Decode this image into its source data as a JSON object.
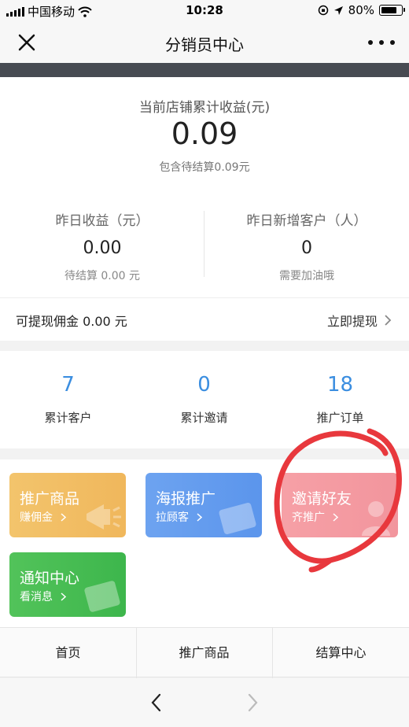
{
  "status_bar": {
    "carrier": "中国移动",
    "time": "10:28",
    "battery": "80%",
    "battery_level": 0.8
  },
  "nav": {
    "title": "分销员中心"
  },
  "earnings": {
    "total_label": "当前店铺累计收益(元)",
    "total_value": "0.09",
    "total_note": "包含待结算0.09元",
    "yesterday_income_label": "昨日收益（元）",
    "yesterday_income_value": "0.00",
    "yesterday_income_note": "待结算 0.00 元",
    "new_customers_label": "昨日新增客户（人）",
    "new_customers_value": "0",
    "new_customers_note": "需要加油哦",
    "withdrawable": "可提现佣金 0.00 元",
    "withdraw_action": "立即提现"
  },
  "counts": [
    {
      "value": "7",
      "label": "累计客户"
    },
    {
      "value": "0",
      "label": "累计邀请"
    },
    {
      "value": "18",
      "label": "推广订单"
    }
  ],
  "tiles": {
    "goods": {
      "title": "推广商品",
      "sub": "赚佣金"
    },
    "poster": {
      "title": "海报推广",
      "sub": "拉顾客"
    },
    "invite": {
      "title": "邀请好友",
      "sub": "齐推广"
    },
    "notice": {
      "title": "通知中心",
      "sub": "看消息"
    }
  },
  "tabs": [
    "首页",
    "推广商品",
    "结算中心"
  ],
  "colors": {
    "accent_blue": "#3b8ee0",
    "annotation_red": "#e8383d",
    "tile_orange": "#f3c46c",
    "tile_blue": "#6da3f0",
    "tile_pink": "#f6a0a6",
    "tile_green": "#52c35a"
  }
}
